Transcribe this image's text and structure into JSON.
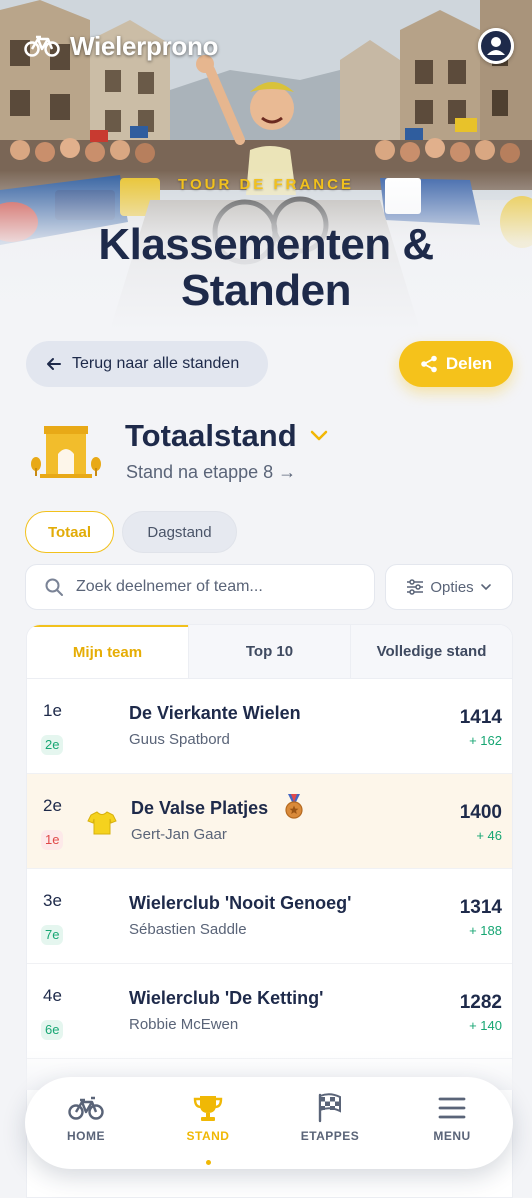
{
  "app": {
    "title": "Wielerprono"
  },
  "hero": {
    "eyebrow": "TOUR DE FRANCE",
    "title_line1": "Klassementen &",
    "title_line2": "Standen"
  },
  "actions": {
    "back_label": "Terug naar alle standen",
    "share_label": "Delen"
  },
  "standing": {
    "title": "Totaalstand",
    "subtitle": "Stand na etappe 8 →"
  },
  "segments": {
    "total": "Totaal",
    "day": "Dagstand"
  },
  "search": {
    "placeholder": "Zoek deelnemer of team..."
  },
  "options": {
    "label": "Opties"
  },
  "tabs": [
    "Mijn team",
    "Top 10",
    "Volledige stand"
  ],
  "rows": [
    {
      "rank": "1e",
      "day_rank": "2e",
      "day_trend": "up",
      "team": "De Vierkante Wielen",
      "player": "Guus Spatbord",
      "points": "1414",
      "gain": "+ 162"
    },
    {
      "rank": "2e",
      "day_rank": "1e",
      "day_trend": "down",
      "team": "De Valse Platjes",
      "player": "Gert-Jan Gaar",
      "points": "1400",
      "gain": "+ 46"
    },
    {
      "rank": "3e",
      "day_rank": "7e",
      "day_trend": "up",
      "team": "Wielerclub 'Nooit Genoeg'",
      "player": "Sébastien Saddle",
      "points": "1314",
      "gain": "+ 188"
    },
    {
      "rank": "4e",
      "day_rank": "6e",
      "day_trend": "up",
      "team": "Wielerclub 'De Ketting'",
      "player": "Robbie McEwen",
      "points": "1282",
      "gain": "+ 140"
    }
  ],
  "nav": {
    "home": "HOME",
    "stand": "STAND",
    "stages": "ETAPPES",
    "menu": "MENU"
  },
  "colors": {
    "accent": "#f5c21b",
    "navy": "#1e2a4a",
    "positive": "#17a673",
    "negative": "#e04848"
  }
}
